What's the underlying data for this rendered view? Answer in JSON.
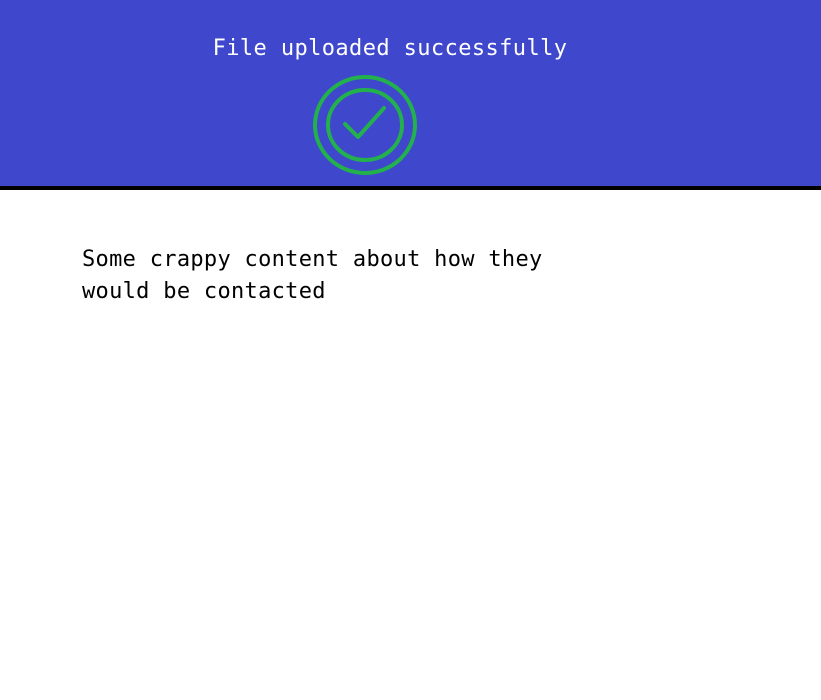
{
  "banner": {
    "title": "File uploaded successfully",
    "background_color": "#3f48cc",
    "icon": "check-circle-icon",
    "icon_color": "#22b14c"
  },
  "main": {
    "message": "Some crappy content about how they would be contacted"
  }
}
